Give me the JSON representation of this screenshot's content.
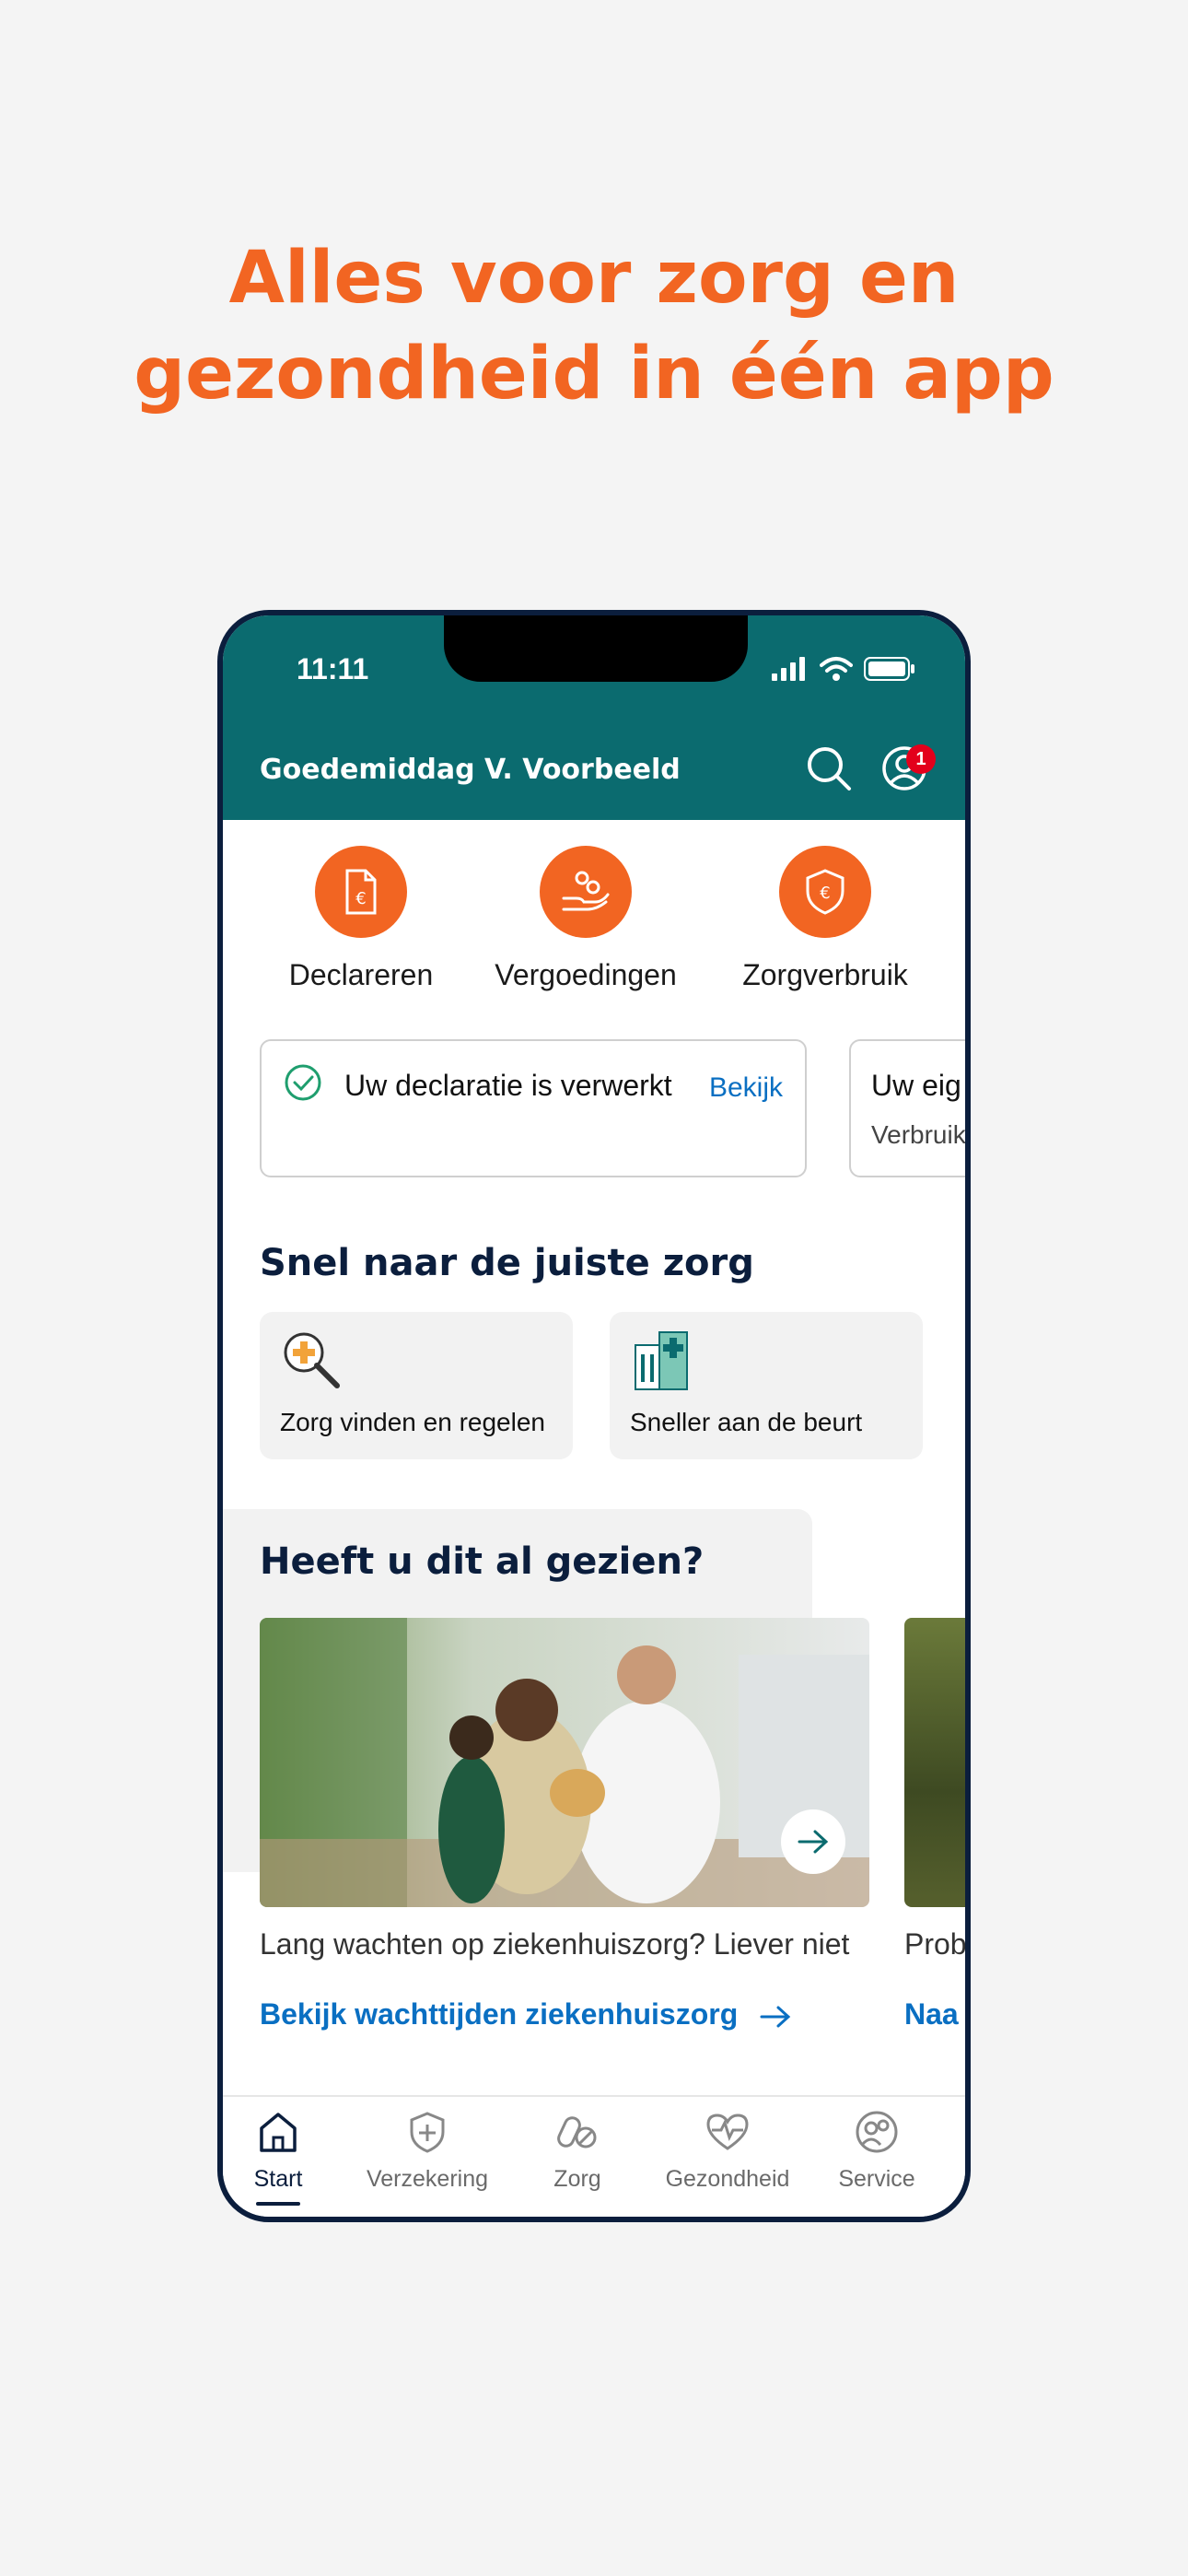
{
  "headline": {
    "line1": "Alles voor zorg en",
    "line2": "gezondheid in één app"
  },
  "status_bar": {
    "time": "11:11"
  },
  "header": {
    "greeting": "Goedemiddag V. Voorbeeld",
    "notification_count": "1"
  },
  "quick_actions": [
    {
      "label": "Declareren",
      "icon": "receipt-euro-icon"
    },
    {
      "label": "Vergoedingen",
      "icon": "hand-coins-icon"
    },
    {
      "label": "Zorgverbruik",
      "icon": "shield-euro-icon"
    }
  ],
  "notifications": [
    {
      "text": "Uw declaratie is verwerkt",
      "link": "Bekijk"
    },
    {
      "text": "Uw eig",
      "subtext": "Verbruik"
    }
  ],
  "quick_care": {
    "title": "Snel naar de juiste zorg",
    "tiles": [
      {
        "label": "Zorg vinden en regelen",
        "icon": "magnifier-plus-icon"
      },
      {
        "label": "Sneller aan de beurt",
        "icon": "hospital-icon"
      }
    ]
  },
  "seen": {
    "title": "Heeft u dit al gezien?",
    "cards": [
      {
        "text": "Lang wachten op ziekenhuiszorg? Liever niet",
        "link": "Bekijk wachttijden ziekenhuiszorg"
      },
      {
        "text": "Prob",
        "link": "Naa"
      }
    ]
  },
  "nav": [
    {
      "label": "Start",
      "icon": "home-icon",
      "active": true
    },
    {
      "label": "Verzekering",
      "icon": "shield-plus-icon"
    },
    {
      "label": "Zorg",
      "icon": "pills-icon"
    },
    {
      "label": "Gezondheid",
      "icon": "heart-pulse-icon"
    },
    {
      "label": "Service",
      "icon": "people-icon"
    }
  ],
  "colors": {
    "brand_orange": "#f26522",
    "teal": "#0b6b6f",
    "navy": "#0b1e3d",
    "link_blue": "#0a6fc2",
    "badge_red": "#e3001b"
  }
}
